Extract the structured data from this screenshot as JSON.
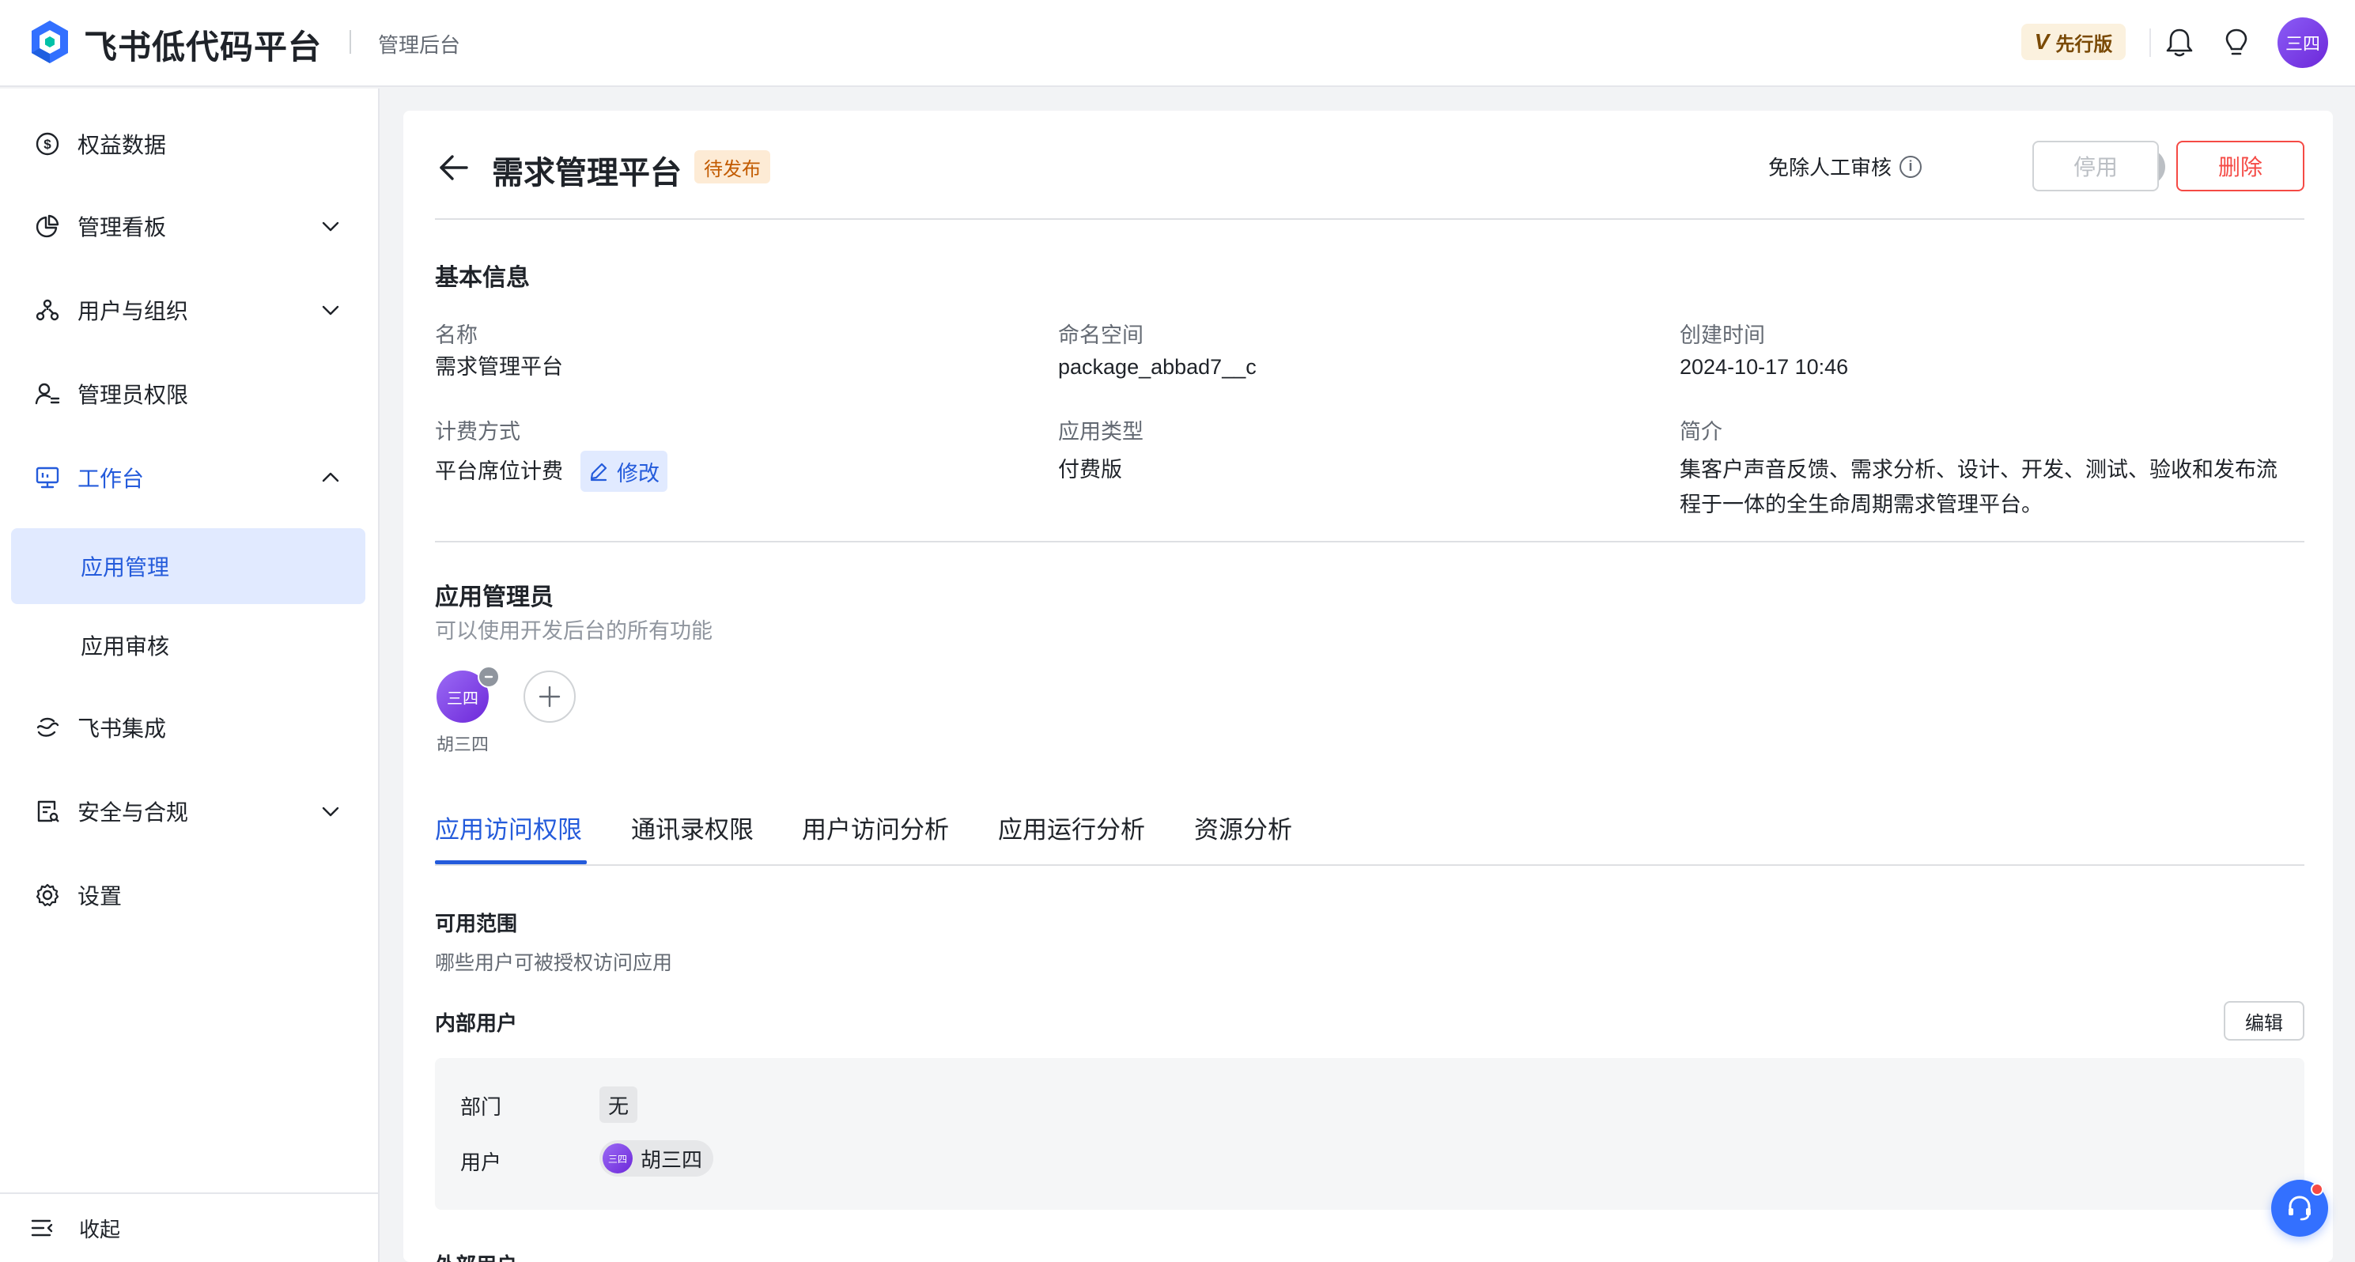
{
  "header": {
    "brand": "飞书低代码平台",
    "subtitle": "管理后台",
    "version_badge": "先行版",
    "version_mark": "V",
    "avatar_text": "三四"
  },
  "sidebar": {
    "items": [
      {
        "label": "权益数据",
        "icon": "dollar-circle-icon"
      },
      {
        "label": "管理看板",
        "icon": "pie-chart-icon"
      },
      {
        "label": "用户与组织",
        "icon": "org-icon"
      },
      {
        "label": "管理员权限",
        "icon": "admin-user-icon"
      },
      {
        "label": "工作台",
        "icon": "monitor-icon"
      },
      {
        "label": "飞书集成",
        "icon": "integration-icon"
      },
      {
        "label": "安全与合规",
        "icon": "security-doc-icon"
      },
      {
        "label": "设置",
        "icon": "gear-icon"
      }
    ],
    "sub_items": [
      {
        "label": "应用管理"
      },
      {
        "label": "应用审核"
      }
    ],
    "collapse_label": "收起"
  },
  "page": {
    "title": "需求管理平台",
    "status": "待发布",
    "review_label": "免除人工审核",
    "info_mark": "i",
    "disable_label": "停用",
    "delete_label": "删除"
  },
  "basic_info": {
    "title": "基本信息",
    "name_label": "名称",
    "name_value": "需求管理平台",
    "namespace_label": "命名空间",
    "namespace_value": "package_abbad7__c",
    "created_label": "创建时间",
    "created_value": "2024-10-17 10:46",
    "billing_label": "计费方式",
    "billing_value": "平台席位计费",
    "billing_edit": "修改",
    "type_label": "应用类型",
    "type_value": "付费版",
    "intro_label": "简介",
    "intro_value_line1": "集客户声音反馈、需求分析、设计、开发、测试、验收和发布流",
    "intro_value_line2": "程于一体的全生命周期需求管理平台。"
  },
  "admins": {
    "title": "应用管理员",
    "desc": "可以使用开发后台的所有功能",
    "avatar_text": "三四",
    "name": "胡三四"
  },
  "tabs": [
    {
      "label": "应用访问权限"
    },
    {
      "label": "通讯录权限"
    },
    {
      "label": "用户访问分析"
    },
    {
      "label": "应用运行分析"
    },
    {
      "label": "资源分析"
    }
  ],
  "access": {
    "scope_title": "可用范围",
    "scope_desc": "哪些用户可被授权访问应用",
    "internal_title": "内部用户",
    "edit_label": "编辑",
    "dept_label": "部门",
    "dept_value": "无",
    "user_label": "用户",
    "user_avatar_text": "三四",
    "user_value": "胡三四",
    "external_title": "外部用户"
  },
  "colors": {
    "accent": "#245bdb",
    "danger": "#f54a45",
    "badge_bg": "#fdebd5",
    "selected_bg": "#e1eaff",
    "avatar": "#7c3aed"
  }
}
